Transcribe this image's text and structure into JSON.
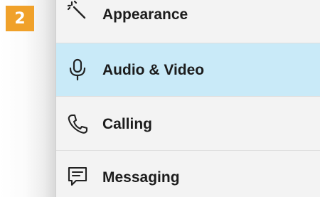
{
  "step_badge": "2",
  "settings_menu": {
    "items": [
      {
        "label": "Appearance",
        "icon": "magic-wand-icon",
        "active": false
      },
      {
        "label": "Audio & Video",
        "icon": "microphone-icon",
        "active": true
      },
      {
        "label": "Calling",
        "icon": "phone-icon",
        "active": false
      },
      {
        "label": "Messaging",
        "icon": "message-icon",
        "active": false
      }
    ]
  },
  "colors": {
    "badge": "#f0a12a",
    "active_item": "#c9eaf8",
    "menu_background": "#f3f3f3"
  }
}
